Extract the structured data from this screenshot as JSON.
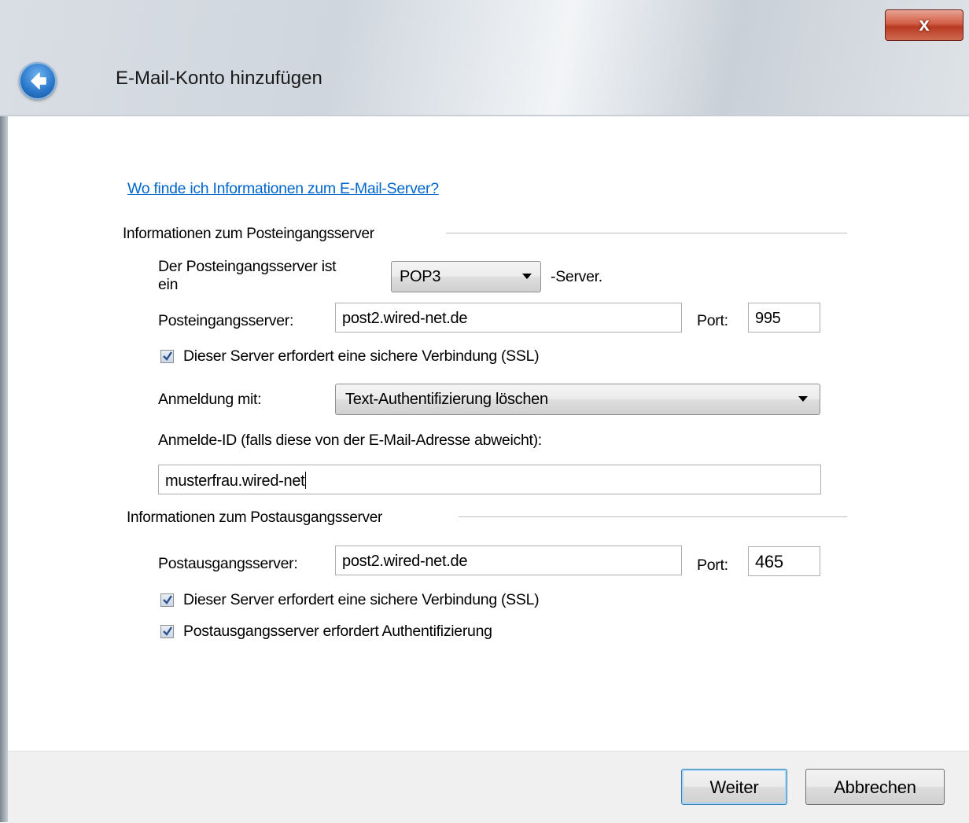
{
  "window": {
    "title": "E-Mail-Konto hinzufügen",
    "close_label": "x",
    "back_icon": "back-arrow-icon"
  },
  "help_link": "Wo finde ich Informationen zum E-Mail-Server?",
  "incoming": {
    "group_label": "Informationen zum Posteingangsserver",
    "type_label_line1": "Der Posteingangsserver ist",
    "type_label_line2": "ein",
    "server_type": "POP3",
    "server_type_suffix": "-Server.",
    "server_label": "Posteingangsserver:",
    "server_value": "post2.wired-net.de",
    "port_label": "Port:",
    "port_value": "995",
    "ssl_label": "Dieser Server erfordert eine sichere Verbindung (SSL)",
    "ssl_checked": true,
    "login_label": "Anmeldung mit:",
    "login_value": "Text-Authentifizierung löschen",
    "login_id_label": "Anmelde-ID (falls diese von der E-Mail-Adresse abweicht):",
    "login_id_value": "musterfrau.wired-net"
  },
  "outgoing": {
    "group_label": "Informationen zum Postausgangsserver",
    "server_label": "Postausgangsserver:",
    "server_value": "post2.wired-net.de",
    "port_label": "Port:",
    "port_value": "465",
    "ssl_label": "Dieser Server erfordert eine sichere Verbindung (SSL)",
    "ssl_checked": true,
    "auth_label": "Postausgangsserver erfordert Authentifizierung",
    "auth_checked": true
  },
  "footer": {
    "next_label": "Weiter",
    "cancel_label": "Abbrechen"
  },
  "colors": {
    "link": "#0066cc",
    "close_button": "#c8452c",
    "back_button": "#2a76c9"
  }
}
